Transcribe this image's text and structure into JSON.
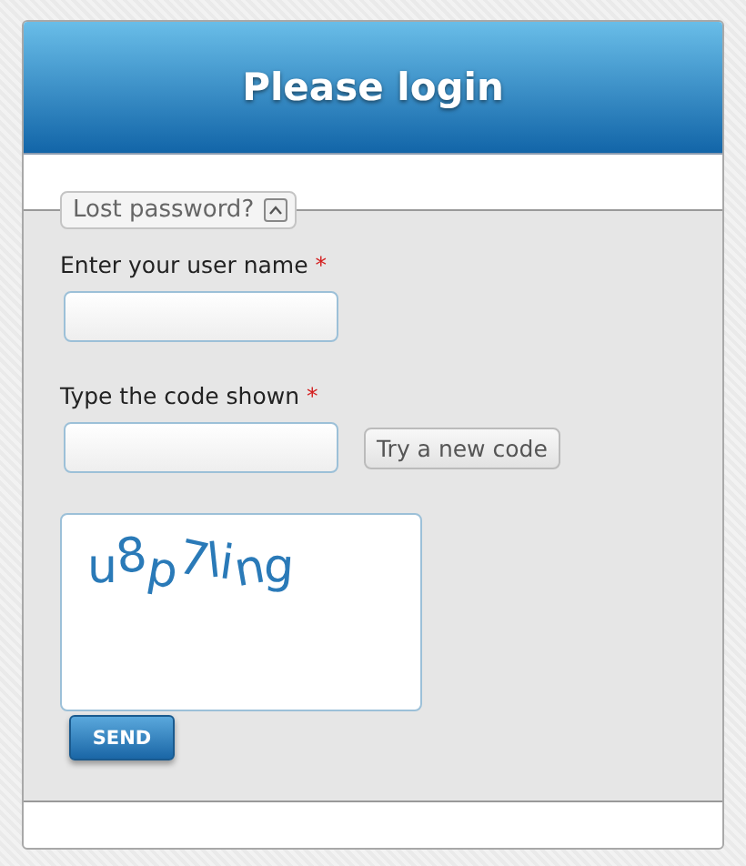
{
  "title": "Please login",
  "legend": {
    "label": "Lost password?",
    "expanded": true
  },
  "fields": [
    {
      "label": "Enter your user name",
      "required_mark": "*",
      "kind": "text"
    },
    {
      "label": "Type the code shown",
      "required_mark": "*",
      "kind": "captcha",
      "button": "Try a new code"
    }
  ],
  "captcha": {
    "text": "u8p7ling"
  },
  "submit": "SEND"
}
